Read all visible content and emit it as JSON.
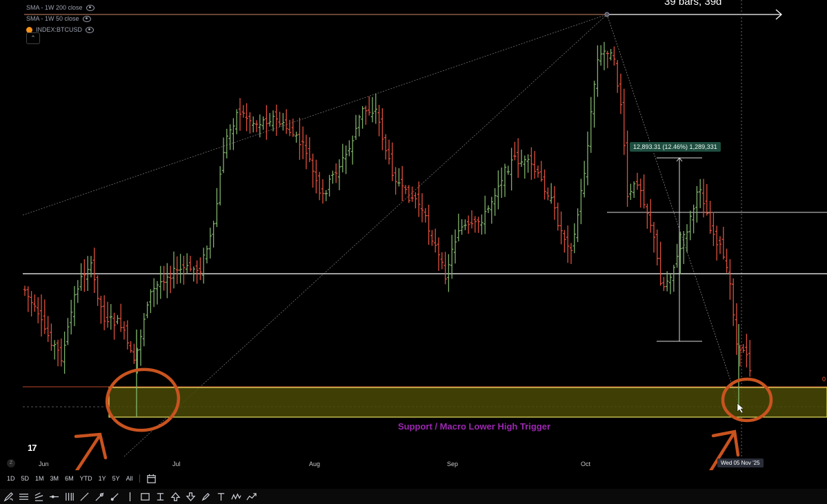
{
  "legend": {
    "sma200": "SMA - 1W 200 close",
    "sma50": "SMA - 1W 50 close",
    "index": "INDEX:BTCUSD",
    "collapse_icon": "chevron-up-icon"
  },
  "top_label": "39 bars, 39d",
  "measure_label": "12,893.31 (12.46%) 1,289,331",
  "support_label": "Support / Macro Lower High Trigger",
  "right_value": "0",
  "tv_logo": "17",
  "months": [
    "Jun",
    "Jul",
    "Aug",
    "Sep",
    "Oct"
  ],
  "date_badge": "Wed 05 Nov '25",
  "tz_badge": "Z",
  "colors": {
    "up": "#7fb26b",
    "down": "#e0503c",
    "support_fill": "#4a4a06",
    "support_border": "#e8e060",
    "annotation": "#c9531f",
    "label_purple": "#9c27b0"
  },
  "range_buttons": [
    "1D",
    "5D",
    "1M",
    "3M",
    "6M",
    "YTD",
    "1Y",
    "5Y",
    "All"
  ],
  "range_icon": "calendar-range-icon",
  "drawing_tools": [
    "pencil-icon",
    "horizontal-lines-icon",
    "pitchfork-icon",
    "horizontal-ray-icon",
    "vertical-lines-icon",
    "trend-line-icon",
    "crosshair-line-icon",
    "brush-icon",
    "vertical-line-icon",
    "rectangle-icon",
    "text-anchor-icon",
    "arrow-up-icon",
    "arrow-down-icon",
    "marker-pen-icon",
    "text-tool-icon",
    "pattern-icon",
    "path-icon"
  ]
}
